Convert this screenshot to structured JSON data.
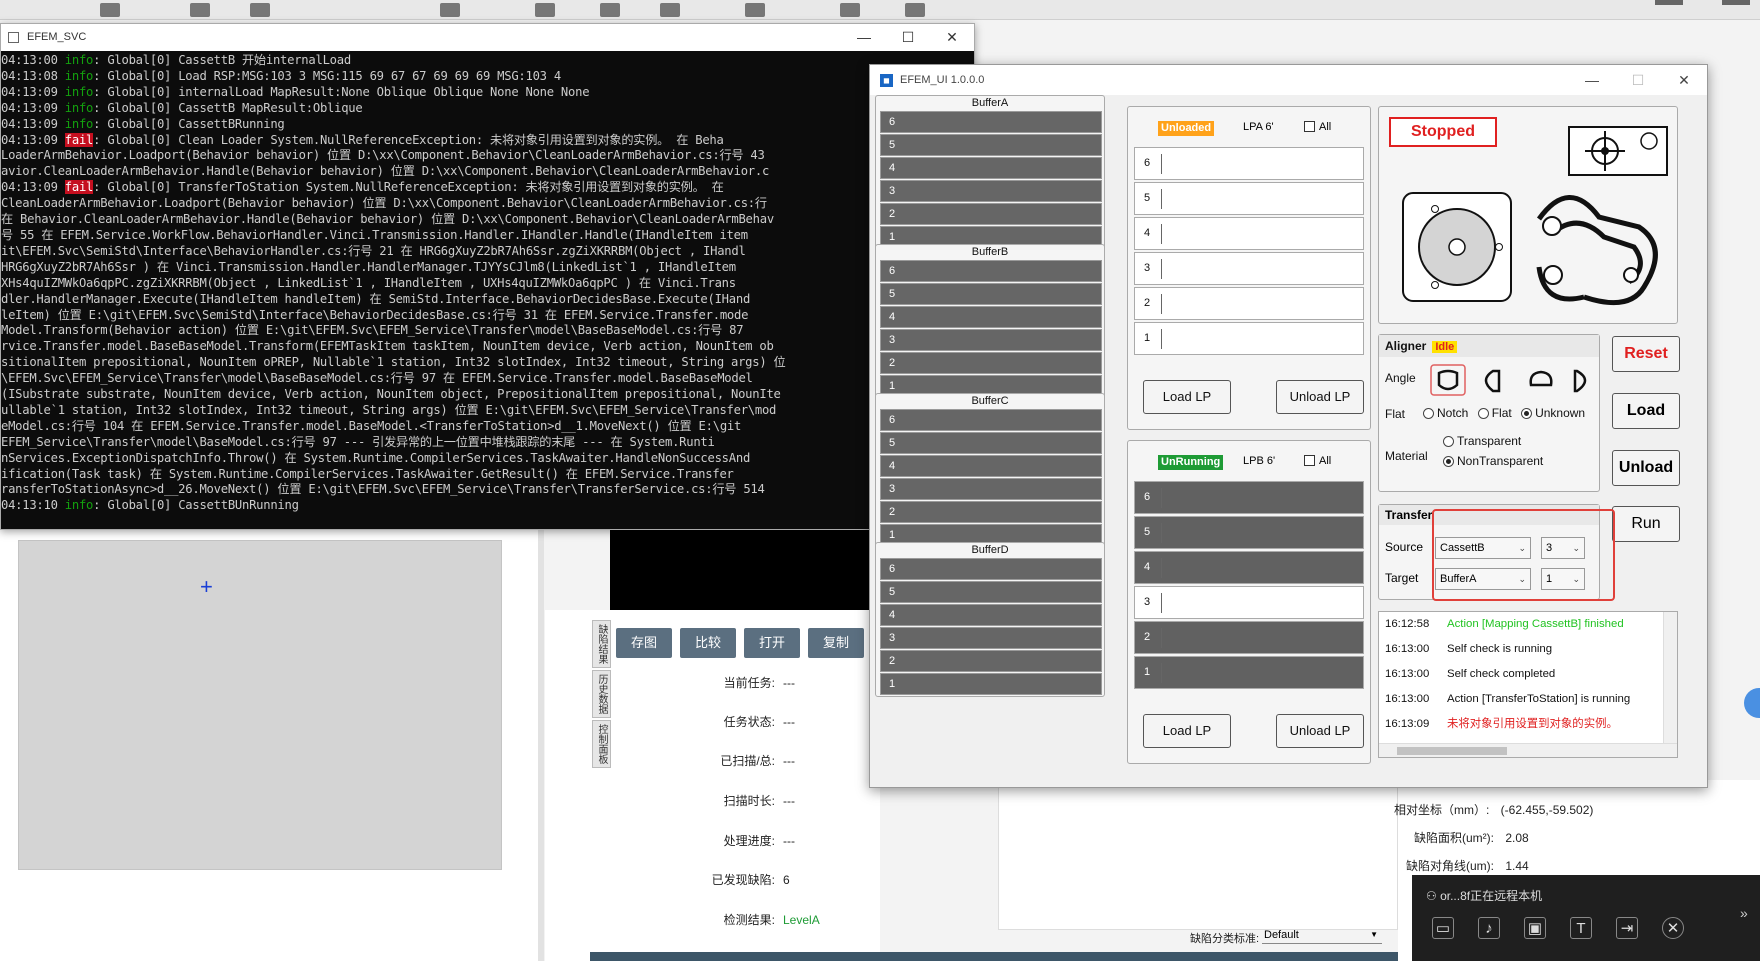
{
  "console": {
    "title": "EFEM_SVC",
    "lines": [
      {
        "time": "04:13:00",
        "level": "info",
        "msg": ": Global[0] CassettB 开始internalLoad"
      },
      {
        "time": "04:13:08",
        "level": "info",
        "msg": ": Global[0] Load RSP:MSG:103 3 MSG:115 69 67 67 69 69 69 MSG:103 4"
      },
      {
        "time": "04:13:09",
        "level": "info",
        "msg": ": Global[0] internalLoad MapResult:None Oblique Oblique None None None"
      },
      {
        "time": "04:13:09",
        "level": "info",
        "msg": ": Global[0] CassettB MapResult:Oblique"
      },
      {
        "time": "04:13:09",
        "level": "info",
        "msg": ": Global[0] CassettBRunning"
      },
      {
        "time": "04:13:09",
        "level": "fail",
        "msg": ": Global[0] Clean Loader System.NullReferenceException: 未将对象引用设置到对象的实例。    在 Beha"
      },
      {
        "time": "",
        "level": "",
        "msg": "LoaderArmBehavior.Loadport(Behavior behavior) 位置 D:\\xx\\Component.Behavior\\CleanLoaderArmBehavior.cs:行号 43"
      },
      {
        "time": "",
        "level": "",
        "msg": "avior.CleanLoaderArmBehavior.Handle(Behavior behavior) 位置 D:\\xx\\Component.Behavior\\CleanLoaderArmBehavior.c"
      },
      {
        "time": "04:13:09",
        "level": "fail",
        "msg": ": Global[0] TransferToStation System.NullReferenceException: 未将对象引用设置到对象的实例。    在"
      },
      {
        "time": "",
        "level": "",
        "msg": "CleanLoaderArmBehavior.Loadport(Behavior behavior) 位置 D:\\xx\\Component.Behavior\\CleanLoaderArmBehavior.cs:行"
      },
      {
        "time": "",
        "level": "",
        "msg": " 在 Behavior.CleanLoaderArmBehavior.Handle(Behavior behavior) 位置 D:\\xx\\Component.Behavior\\CleanLoaderArmBehav"
      },
      {
        "time": "",
        "level": "",
        "msg": "号 55    在 EFEM.Service.WorkFlow.BehaviorHandler.Vinci.Transmission.Handler.IHandler.Handle(IHandleItem item"
      },
      {
        "time": "",
        "level": "",
        "msg": "it\\EFEM.Svc\\SemiStd\\Interface\\BehaviorHandler.cs:行号 21    在 HRG6gXuyZ2bR7Ah6Ssr.zgZiXKRRBM(Object , IHandl"
      },
      {
        "time": "",
        "level": "",
        "msg": " HRG6gXuyZ2bR7Ah6Ssr )    在 Vinci.Transmission.Handler.HandlerManager.TJYYsCJlm8(LinkedList`1 , IHandleItem"
      },
      {
        "time": "",
        "level": "",
        "msg": "XHs4quIZMWkOa6qpPC.zgZiXKRRBM(Object , LinkedList`1 , IHandleItem , UXHs4quIZMWkOa6qpPC )    在 Vinci.Trans"
      },
      {
        "time": "",
        "level": "",
        "msg": "dler.HandlerManager.Execute(IHandleItem handleItem)    在 SemiStd.Interface.BehaviorDecidesBase.Execute(IHand"
      },
      {
        "time": "",
        "level": "",
        "msg": "leItem) 位置 E:\\git\\EFEM.Svc\\SemiStd\\Interface\\BehaviorDecidesBase.cs:行号 31    在 EFEM.Service.Transfer.mode"
      },
      {
        "time": "",
        "level": "",
        "msg": "Model.Transform(Behavior action) 位置 E:\\git\\EFEM.Svc\\EFEM_Service\\Transfer\\model\\BaseBaseModel.cs:行号 87"
      },
      {
        "time": "",
        "level": "",
        "msg": "rvice.Transfer.model.BaseBaseModel.Transform(EFEMTaskItem taskItem, NounItem device, Verb action, NounItem ob"
      },
      {
        "time": "",
        "level": "",
        "msg": "sitionalItem prepositional, NounItem oPREP, Nullable`1 station, Int32 slotIndex, Int32 timeout, String args) 位"
      },
      {
        "time": "",
        "level": "",
        "msg": "\\EFEM.Svc\\EFEM_Service\\Transfer\\model\\BaseBaseModel.cs:行号 97    在 EFEM.Service.Transfer.model.BaseBaseModel"
      },
      {
        "time": "",
        "level": "",
        "msg": "(ISubstrate substrate, NounItem device, Verb action, NounItem object, PrepositionalItem prepositional, NounIte"
      },
      {
        "time": "",
        "level": "",
        "msg": "ullable`1 station, Int32 slotIndex, Int32 timeout, String args) 位置 E:\\git\\EFEM.Svc\\EFEM_Service\\Transfer\\mod"
      },
      {
        "time": "",
        "level": "",
        "msg": "eModel.cs:行号 104    在 EFEM.Service.Transfer.model.BaseModel.<TransferToStation>d__1.MoveNext() 位置 E:\\git"
      },
      {
        "time": "",
        "level": "",
        "msg": "EFEM_Service\\Transfer\\model\\BaseModel.cs:行号 97 --- 引发异常的上一位置中堆栈跟踪的末尾 ---    在 System.Runti"
      },
      {
        "time": "",
        "level": "",
        "msg": "nServices.ExceptionDispatchInfo.Throw()    在 System.Runtime.CompilerServices.TaskAwaiter.HandleNonSuccessAnd"
      },
      {
        "time": "",
        "level": "",
        "msg": "ification(Task task)    在 System.Runtime.CompilerServices.TaskAwaiter.GetResult()    在 EFEM.Service.Transfer"
      },
      {
        "time": "",
        "level": "",
        "msg": "ransferToStationAsync>d__26.MoveNext() 位置 E:\\git\\EFEM.Svc\\EFEM_Service\\Transfer\\TransferService.cs:行号 514"
      },
      {
        "time": "04:13:10",
        "level": "info",
        "msg": ": Global[0] CassettBUnRunning"
      }
    ]
  },
  "efem": {
    "title": "EFEM_UI 1.0.0.0",
    "buffers": [
      {
        "name": "BufferA",
        "slots": [
          "6",
          "5",
          "4",
          "3",
          "2",
          "1"
        ]
      },
      {
        "name": "BufferB",
        "slots": [
          "6",
          "5",
          "4",
          "3",
          "2",
          "1"
        ]
      },
      {
        "name": "BufferC",
        "slots": [
          "6",
          "5",
          "4",
          "3",
          "2",
          "1"
        ]
      },
      {
        "name": "BufferD",
        "slots": [
          "6",
          "5",
          "4",
          "3",
          "2",
          "1"
        ]
      }
    ],
    "lpa": {
      "status": "Unloaded",
      "status_color": "#ffa21a",
      "name": "LPA  6'",
      "all_label": "All",
      "slots": [
        {
          "n": "6",
          "state": "white"
        },
        {
          "n": "5",
          "state": "white"
        },
        {
          "n": "4",
          "state": "white"
        },
        {
          "n": "3",
          "state": "white"
        },
        {
          "n": "2",
          "state": "white"
        },
        {
          "n": "1",
          "state": "white"
        }
      ],
      "load_label": "Load LP",
      "unload_label": "Unload LP"
    },
    "lpb": {
      "status": "UnRunning",
      "status_color": "#1e9b35",
      "name": "LPB  6'",
      "all_label": "All",
      "slots": [
        {
          "n": "6",
          "state": "dark"
        },
        {
          "n": "5",
          "state": "dark"
        },
        {
          "n": "4",
          "state": "dark"
        },
        {
          "n": "3",
          "state": "white"
        },
        {
          "n": "2",
          "state": "dark"
        },
        {
          "n": "1",
          "state": "dark"
        }
      ],
      "load_label": "Load LP",
      "unload_label": "Unload LP"
    },
    "robot_status": "Stopped",
    "aligner": {
      "title": "Aligner",
      "state": "Idle",
      "angle_label": "Angle",
      "flat_label": "Flat",
      "flat_options": [
        "Notch",
        "Flat",
        "Unknown"
      ],
      "flat_selected": "Unknown",
      "material_label": "Material",
      "material_options": [
        "Transparent",
        "NonTransparent"
      ],
      "material_selected": "NonTransparent"
    },
    "side_buttons": {
      "reset": "Reset",
      "load": "Load",
      "unload": "Unload",
      "run": "Run"
    },
    "transfer": {
      "title": "Transfer",
      "source_label": "Source",
      "source_value": "CassettB",
      "source_slot": "3",
      "target_label": "Target",
      "target_value": "BufferA",
      "target_slot": "1"
    },
    "log": [
      {
        "time": "16:12:58",
        "text": "Action [Mapping CassettB] finished",
        "color": "#22c322"
      },
      {
        "time": "16:13:00",
        "text": "Self check is running",
        "color": "#111111"
      },
      {
        "time": "16:13:00",
        "text": "Self check completed",
        "color": "#111111"
      },
      {
        "time": "16:13:00",
        "text": "Action [TransferToStation] is running",
        "color": "#111111"
      },
      {
        "time": "16:13:09",
        "text": "未将对象引用设置到对象的实例。",
        "color": "#e02020"
      }
    ]
  },
  "background": {
    "buttons": [
      "存图",
      "比较",
      "打开",
      "复制"
    ],
    "vtabs": [
      "缺陷结果",
      "历史数据",
      "控制面板"
    ],
    "info": [
      {
        "label": "当前任务:",
        "value": "---"
      },
      {
        "label": "任务状态:",
        "value": "---"
      },
      {
        "label": "已扫描/总:",
        "value": "---"
      },
      {
        "label": "扫描时长:",
        "value": "---"
      },
      {
        "label": "处理进度:",
        "value": "---"
      },
      {
        "label": "已发现缺陷:",
        "value": "6"
      },
      {
        "label": "检测结果:",
        "value": "LevelA"
      }
    ],
    "metrics": [
      {
        "label": "相对坐标（mm）:",
        "value": "(-62.455,-59.502)"
      },
      {
        "label": "缺陷面积(um²):",
        "value": "2.08"
      },
      {
        "label": "缺陷对角线(um):",
        "value": "1.44"
      }
    ],
    "defect_std_label": "缺陷分类标准:",
    "defect_std_value": "Default",
    "remote_text": "or...8f正在远程本机"
  }
}
